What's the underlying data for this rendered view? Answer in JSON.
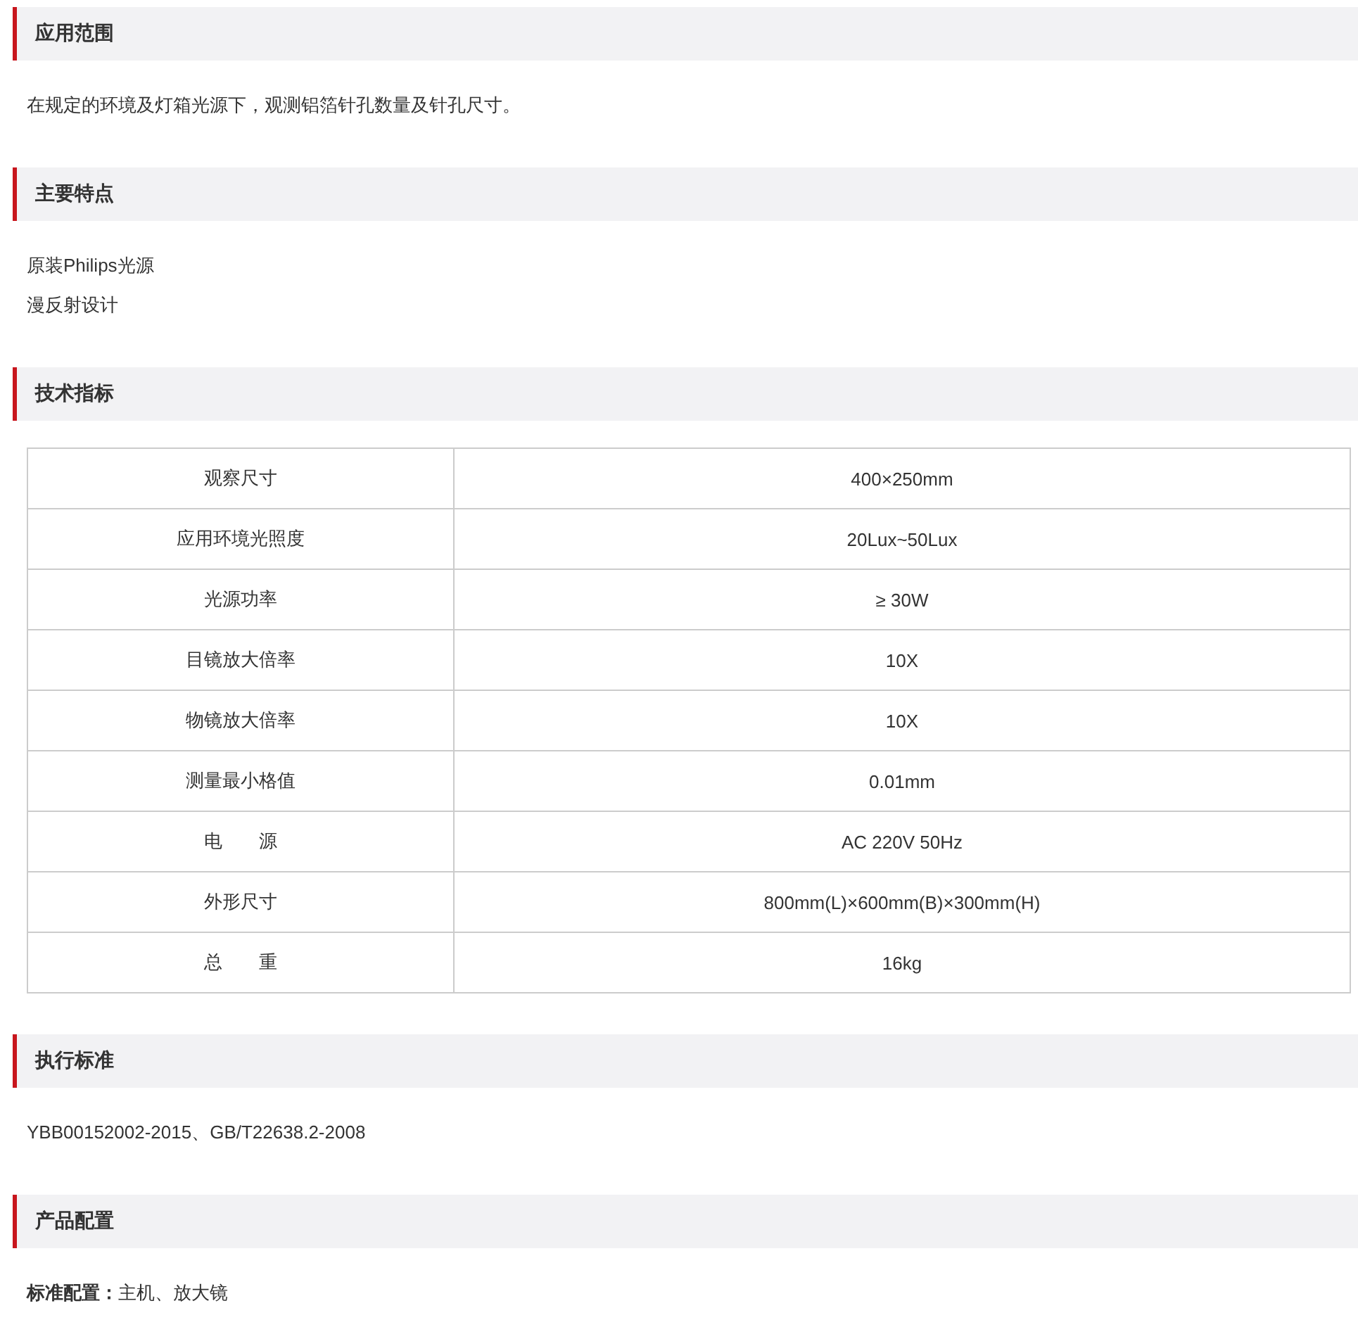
{
  "sections": [
    {
      "title": "应用范围",
      "kind": "text",
      "text": "在规定的环境及灯箱光源下，观测铝箔针孔数量及针孔尺寸。"
    },
    {
      "title": "主要特点",
      "kind": "list",
      "items": [
        "原装Philips光源",
        "漫反射设计"
      ]
    },
    {
      "title": "技术指标",
      "kind": "table",
      "rows": [
        {
          "label": "观察尺寸",
          "value": "400×250mm"
        },
        {
          "label": "应用环境光照度",
          "value": "20Lux~50Lux"
        },
        {
          "label": "光源功率",
          "value": "≥ 30W"
        },
        {
          "label": "目镜放大倍率",
          "value": "10X"
        },
        {
          "label": "物镜放大倍率",
          "value": "10X"
        },
        {
          "label": "测量最小格值",
          "value": "0.01mm"
        },
        {
          "label": "电　　源",
          "value": "AC 220V 50Hz"
        },
        {
          "label": "外形尺寸",
          "value": "800mm(L)×600mm(B)×300mm(H)"
        },
        {
          "label": "总　　重",
          "value": "16kg"
        }
      ]
    },
    {
      "title": "执行标准",
      "kind": "text",
      "text": "YBB00152002-2015、GB/T22638.2-2008"
    },
    {
      "title": "产品配置",
      "kind": "text",
      "text": "**标准配置：**主机、放大镜"
    }
  ]
}
